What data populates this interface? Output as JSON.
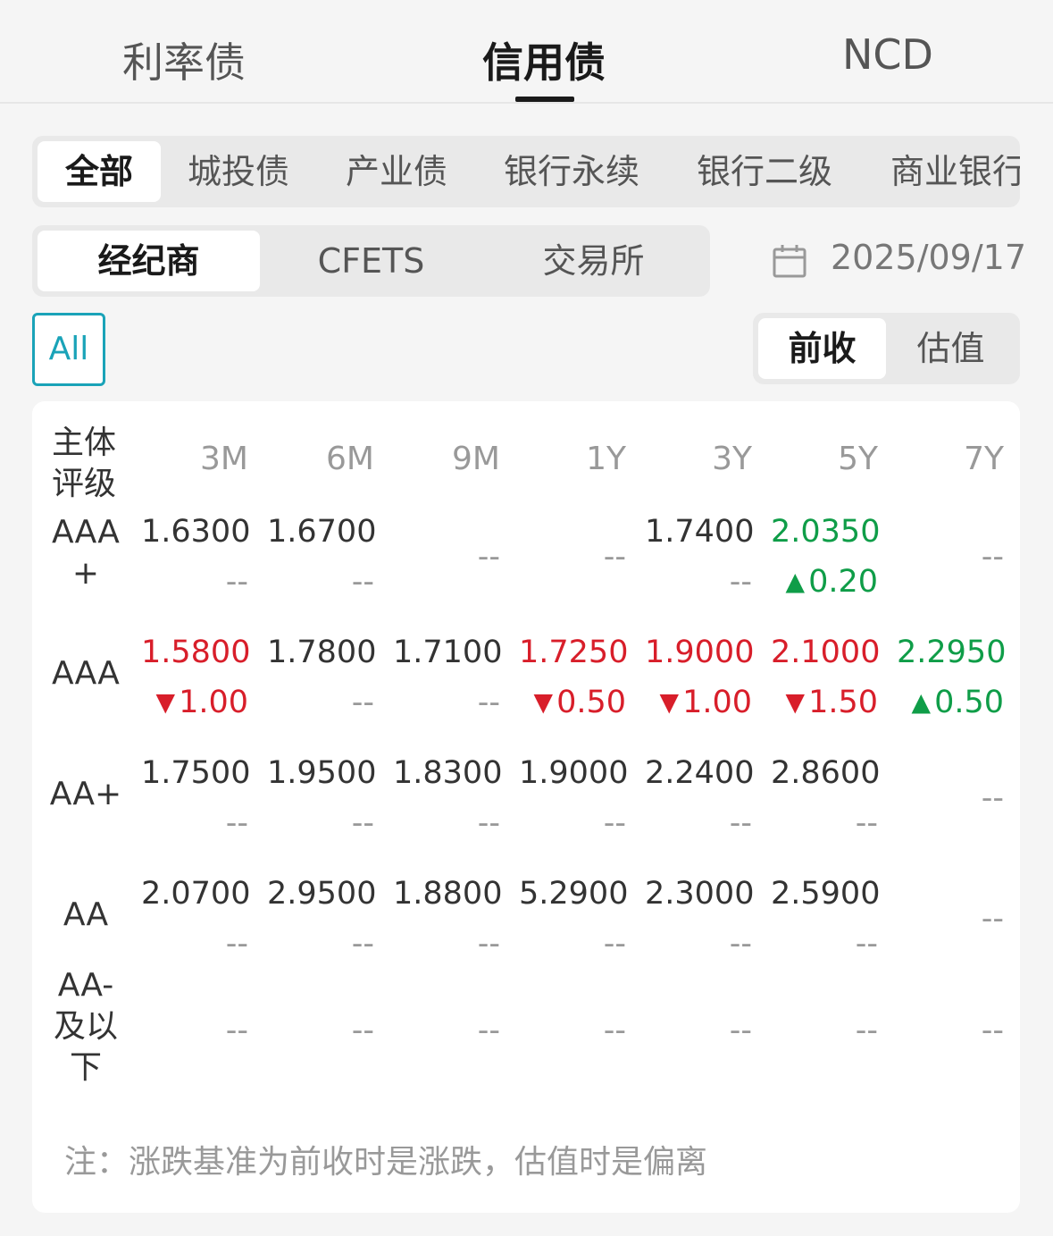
{
  "top_tabs": [
    "利率债",
    "信用债",
    "NCD"
  ],
  "categories": [
    "全部",
    "城投债",
    "产业债",
    "银行永续",
    "银行二级",
    "商业银行"
  ],
  "sources": [
    "经纪商",
    "CFETS",
    "交易所"
  ],
  "date": "2025/09/17",
  "all_button": "All",
  "modes": [
    "前收",
    "估值"
  ],
  "table": {
    "rating_header": "主体\n评级",
    "columns": [
      "3M",
      "6M",
      "9M",
      "1Y",
      "3Y",
      "5Y",
      "7Y"
    ],
    "rows": [
      {
        "label": "AAA\n+",
        "cells": [
          {
            "v": "1.6300",
            "c": "--",
            "color": "black"
          },
          {
            "v": "1.6700",
            "c": "--",
            "color": "black"
          },
          {
            "v": "",
            "c": "--",
            "color": "dash"
          },
          {
            "v": "",
            "c": "--",
            "color": "dash"
          },
          {
            "v": "1.7400",
            "c": "--",
            "color": "black"
          },
          {
            "v": "2.0350",
            "c": "0.20",
            "dir": "up",
            "color": "green"
          },
          {
            "v": "",
            "c": "--",
            "color": "dash"
          }
        ]
      },
      {
        "label": "AAA",
        "cells": [
          {
            "v": "1.5800",
            "c": "1.00",
            "dir": "down",
            "color": "red"
          },
          {
            "v": "1.7800",
            "c": "--",
            "color": "black"
          },
          {
            "v": "1.7100",
            "c": "--",
            "color": "black"
          },
          {
            "v": "1.7250",
            "c": "0.50",
            "dir": "down",
            "color": "red"
          },
          {
            "v": "1.9000",
            "c": "1.00",
            "dir": "down",
            "color": "red"
          },
          {
            "v": "2.1000",
            "c": "1.50",
            "dir": "down",
            "color": "red"
          },
          {
            "v": "2.2950",
            "c": "0.50",
            "dir": "up",
            "color": "green"
          }
        ]
      },
      {
        "label": "AA+",
        "cells": [
          {
            "v": "1.7500",
            "c": "--",
            "color": "black"
          },
          {
            "v": "1.9500",
            "c": "--",
            "color": "black"
          },
          {
            "v": "1.8300",
            "c": "--",
            "color": "black"
          },
          {
            "v": "1.9000",
            "c": "--",
            "color": "black"
          },
          {
            "v": "2.2400",
            "c": "--",
            "color": "black"
          },
          {
            "v": "2.8600",
            "c": "--",
            "color": "black"
          },
          {
            "v": "",
            "c": "--",
            "color": "dash"
          }
        ]
      },
      {
        "label": "AA",
        "cells": [
          {
            "v": "2.0700",
            "c": "--",
            "color": "black"
          },
          {
            "v": "2.9500",
            "c": "--",
            "color": "black"
          },
          {
            "v": "1.8800",
            "c": "--",
            "color": "black"
          },
          {
            "v": "5.2900",
            "c": "--",
            "color": "black"
          },
          {
            "v": "2.3000",
            "c": "--",
            "color": "black"
          },
          {
            "v": "2.5900",
            "c": "--",
            "color": "black"
          },
          {
            "v": "",
            "c": "--",
            "color": "dash"
          }
        ]
      },
      {
        "label": "AA-\n及以\n下",
        "cells": [
          {
            "v": "",
            "c": "--",
            "color": "dash"
          },
          {
            "v": "",
            "c": "--",
            "color": "dash"
          },
          {
            "v": "",
            "c": "--",
            "color": "dash"
          },
          {
            "v": "",
            "c": "--",
            "color": "dash"
          },
          {
            "v": "",
            "c": "--",
            "color": "dash"
          },
          {
            "v": "",
            "c": "--",
            "color": "dash"
          },
          {
            "v": "",
            "c": "--",
            "color": "dash"
          }
        ]
      }
    ]
  },
  "note": "注：涨跌基准为前收时是涨跌，估值时是偏离",
  "colors": {
    "accent": "#1aa3b8",
    "up": "#0f9d48",
    "down": "#d81e2a"
  }
}
